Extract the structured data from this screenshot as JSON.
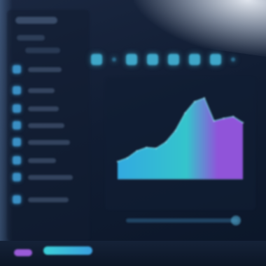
{
  "window": {
    "title": ""
  },
  "sidebar": {
    "brand": "",
    "items": [
      {
        "icon": "chart-icon",
        "label": ""
      },
      {
        "icon": "grid-icon",
        "label": ""
      },
      {
        "icon": "users-icon",
        "label": ""
      },
      {
        "icon": "folder-icon",
        "label": ""
      },
      {
        "icon": "calendar-icon",
        "label": ""
      },
      {
        "icon": "settings-icon",
        "label": ""
      },
      {
        "icon": "message-icon",
        "label": ""
      },
      {
        "icon": "bell-icon",
        "label": ""
      }
    ]
  },
  "toolbar": {
    "icons": [
      "home-icon",
      "dot-icon",
      "layers-icon",
      "pie-icon",
      "filter-icon",
      "refresh-icon",
      "export-icon",
      "more-icon"
    ]
  },
  "chart_data": {
    "type": "area",
    "x": [
      0,
      1,
      2,
      3,
      4,
      5,
      6,
      7,
      8,
      9,
      10,
      11,
      12,
      13
    ],
    "series": [
      {
        "values": [
          2,
          2.4,
          3.2,
          3.6,
          3.5,
          4.2,
          5.5,
          7.5,
          8.8,
          9.2,
          6.6,
          6.9,
          7.1,
          6.4
        ]
      }
    ],
    "title": "",
    "xlabel": "",
    "ylabel": "",
    "ylim": [
      0,
      10
    ],
    "grid": false,
    "colors": {
      "start": "#35b6f0",
      "mid": "#38d4d9",
      "end": "#9b59e8"
    }
  },
  "theme": {
    "background": "#111d33",
    "accent": "#3fa7c9",
    "highlight_purple": "#9a5bd8",
    "highlight_cyan": "#3bd1d8"
  }
}
